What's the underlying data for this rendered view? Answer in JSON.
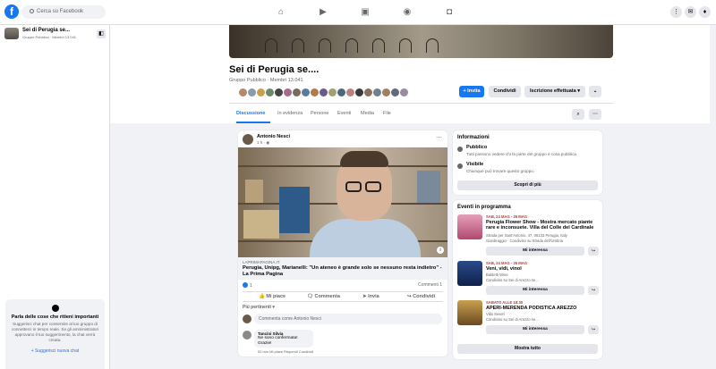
{
  "topbar": {
    "search_placeholder": "Cerca su Facebook",
    "logo": "f"
  },
  "left": {
    "group_name": "Sei di Perugia se...",
    "group_meta": "Gruppo Pubblico · Membri 13.041",
    "chat": {
      "title": "Parla delle cose che ritieni importanti",
      "desc": "Suggerisci chat per consentire al tuo gruppo di connetterci in tempo reale. Se gli amministratori approvano il tuo suggerimento, la chat verrà creata.",
      "link": "+ Suggerisci nuova chat"
    }
  },
  "group": {
    "title": "Sei di Perugia se....",
    "meta": "Gruppo Pubblico · Membri 13.041",
    "buttons": {
      "invite": "+ Invita",
      "share": "Condividi",
      "joined": "Iscrizione effettuata ▾",
      "more": "⌄"
    },
    "tabs": [
      "Discussione",
      "In evidenza",
      "Persone",
      "Eventi",
      "Media",
      "File"
    ]
  },
  "post": {
    "author": "Antonio Nesci",
    "time": "1 h · ◉",
    "link_source": "LAPRIMAPAGINA.IT",
    "link_title": "Perugia, Unipg, Marianelli: \"Un ateneo è grande solo se nessuno resta indietro\" - La Prima Pagina",
    "likes": "1",
    "comments": "Commenti 1",
    "actions": [
      "Mi piace",
      "Commenta",
      "Invia",
      "Condividi"
    ],
    "filter": "Più pertinenti ▾",
    "comment_placeholder": "Commenta come Antonio Nesci",
    "comment": {
      "name": "Tancini Silvia",
      "text": "Ne sono confermata! Grazie!",
      "meta": "52 min   Mi piace   Rispondi   Condividi"
    }
  },
  "info": {
    "title": "Informazioni",
    "public_title": "Pubblico",
    "public_desc": "Tutti possono vedere chi fa parte del gruppo e cosa pubblica.",
    "visible_title": "Visibile",
    "visible_desc": "Chiunque può trovare questo gruppo.",
    "more": "Scopri di più"
  },
  "events": {
    "title": "Eventi in programma",
    "items": [
      {
        "date": "SAB, 24 MAG - 26 MAG",
        "name": "Perugia Flower Show - Mostra mercato piante rare e inconsuete. Villa del Colle del Cardinale",
        "place": "Strada per Sant'Antonio, 47, 06133 Perugia, Italy",
        "org": "Gianbraggio · Condiviso su Strada dell'Umbria"
      },
      {
        "date": "SAB, 24 MAG - 26 MAG",
        "name": "Veni, vidi, vinol",
        "place": "Baldetti Wine",
        "org": "Condiviso su Sei di Arezzo se..."
      },
      {
        "date": "SABATO ALLE 18:30",
        "name": "APERI-MERENDA PODISTICA AREZZO",
        "place": "Villa Severi",
        "org": "Condiviso su Sei di Arezzo se..."
      }
    ],
    "interested": "Mi interessa",
    "show_all": "Mostra tutto"
  },
  "colors": {
    "accent": "#1877f2",
    "page_bg": "#f0f2f5"
  }
}
